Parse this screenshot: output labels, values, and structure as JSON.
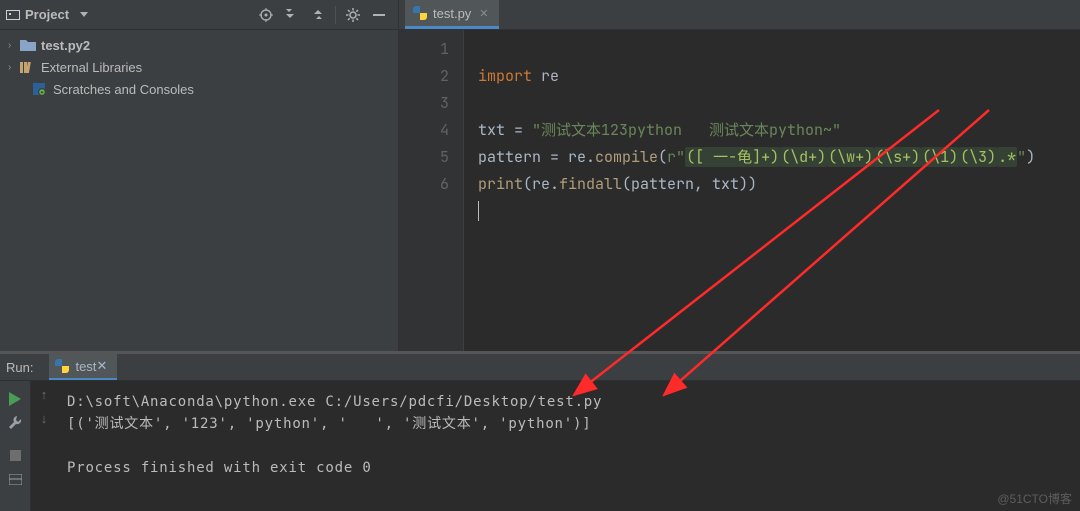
{
  "sidebar": {
    "title": "Project",
    "items": [
      {
        "label": "test.py2",
        "icon": "folder",
        "bold": true,
        "arrow": ">"
      },
      {
        "label": "External Libraries",
        "icon": "ext-lib",
        "bold": false,
        "arrow": ">"
      },
      {
        "label": "Scratches and Consoles",
        "icon": "scratch",
        "bold": false,
        "arrow": ""
      }
    ]
  },
  "tab": {
    "label": "test.py"
  },
  "code": {
    "lines": [
      1,
      2,
      3,
      4,
      5,
      6
    ],
    "l1_import": "import",
    "l1_mod": " re",
    "l3a": "txt = ",
    "l3s": "\"测试文本123python   测试文本python~\"",
    "l4a": "pattern = re.",
    "l4fn": "compile",
    "l4b": "(",
    "l4r": "r\"",
    "l4g1": "([ 一-龟]+)",
    "l4g2": "(\\d+)",
    "l4g3": "(\\w+)",
    "l4g4": "(\\s+)",
    "l4g5": "(\\1)",
    "l4g6": "(\\3)",
    "l4g7": ".*",
    "l4e": "\"",
    "l4c": ")",
    "l5a": "",
    "l5fn": "print",
    "l5b": "(re.",
    "l5fn2": "findall",
    "l5c": "(pattern, txt))"
  },
  "run": {
    "label": "Run:",
    "tab": "test",
    "out1": "D:\\soft\\Anaconda\\python.exe C:/Users/pdcfi/Desktop/test.py",
    "out2": "[('测试文本', '123', 'python', '   ', '测试文本', 'python')]",
    "out3": "",
    "out4": "Process finished with exit code 0"
  },
  "watermark": "@51CTO博客"
}
